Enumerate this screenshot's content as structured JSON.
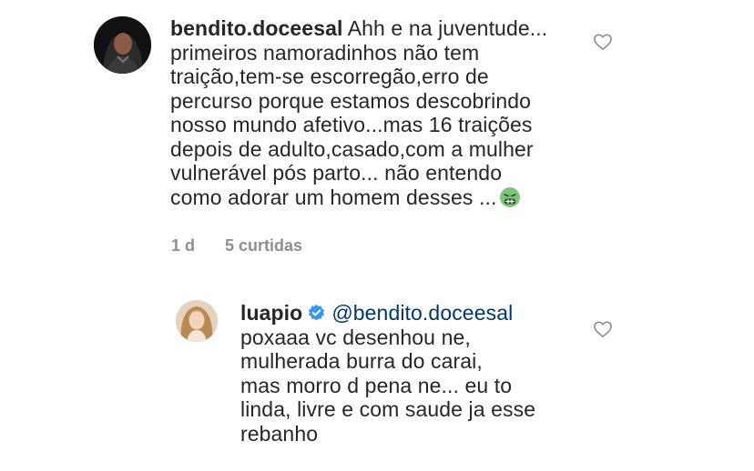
{
  "comment": {
    "username": "bendito.doceesal",
    "lines": [
      "Ahh e na juventude...",
      "primeiros namoradinhos não tem",
      "traição,tem-se escorregão,erro de",
      "percurso porque estamos descobrindo",
      "nosso mundo afetivo...mas 16 traições",
      "depois de adulto,casado,com a mulher",
      "vulnerável pós parto... não entendo",
      "como adorar um homem desses ..."
    ],
    "emoji_icon": "nauseated-face-emoji",
    "time": "1 d",
    "likes": "5 curtidas",
    "like_icon": "heart-outline-icon"
  },
  "reply": {
    "username": "luapio",
    "verified_icon": "verified-badge-icon",
    "mention": "@bendito.doceesal",
    "lines": [
      "poxaaa vc desenhou ne,",
      "mulherada burra do carai,",
      "mas morro d pena ne... eu to",
      "linda, livre e com saude ja esse",
      "rebanho"
    ],
    "like_icon": "heart-outline-icon"
  },
  "colors": {
    "text": "#262626",
    "secondary": "#8e8e8e",
    "link": "#00376b",
    "verified": "#3897f0"
  }
}
